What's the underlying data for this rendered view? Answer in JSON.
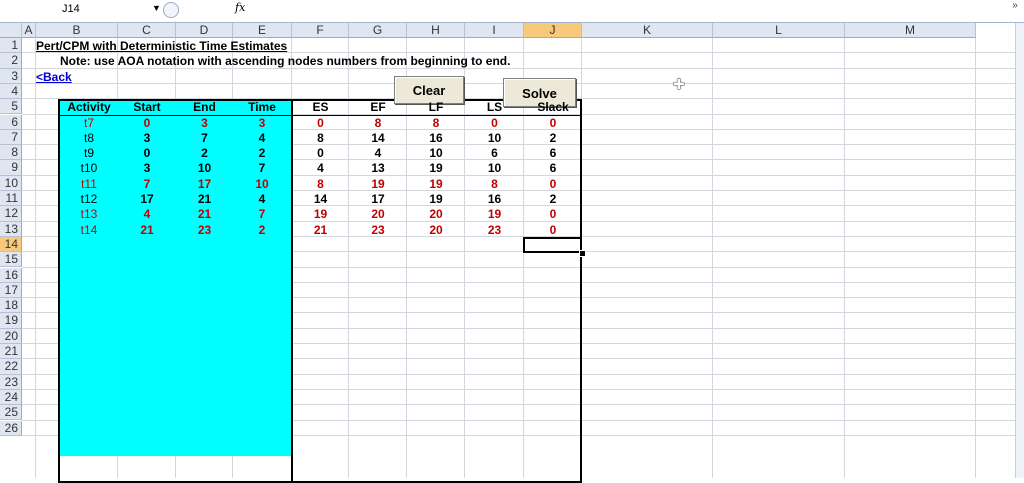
{
  "formula_bar": {
    "cell_ref": "J14",
    "fx_symbol": "fx",
    "expand": "»",
    "content": ""
  },
  "columns": [
    "A",
    "B",
    "C",
    "D",
    "E",
    "F",
    "G",
    "H",
    "I",
    "J",
    "K",
    "L",
    "M"
  ],
  "rows": [
    "1",
    "2",
    "3",
    "4",
    "5",
    "6",
    "7",
    "8",
    "9",
    "10",
    "11",
    "12",
    "13",
    "14",
    "15",
    "16",
    "17",
    "18",
    "19",
    "20",
    "21",
    "22",
    "23",
    "24",
    "25",
    "26"
  ],
  "selected": {
    "column": "J",
    "row": "14"
  },
  "sheet": {
    "title": "Pert/CPM with Deterministic Time Estimates",
    "note": "Note: use AOA notation with ascending nodes numbers from beginning to end.",
    "back_link": "<Back"
  },
  "buttons": {
    "clear": "Clear",
    "solve": "Solve"
  },
  "input_table": {
    "headers": [
      "Activity",
      "Start",
      "End",
      "Time"
    ],
    "rows": [
      {
        "activity": "t7",
        "start": "0",
        "end": "3",
        "time": "3",
        "critical": true
      },
      {
        "activity": "t8",
        "start": "3",
        "end": "7",
        "time": "4",
        "critical": false
      },
      {
        "activity": "t9",
        "start": "0",
        "end": "2",
        "time": "2",
        "critical": false
      },
      {
        "activity": "t10",
        "start": "3",
        "end": "10",
        "time": "7",
        "critical": false
      },
      {
        "activity": "t11",
        "start": "7",
        "end": "17",
        "time": "10",
        "critical": true
      },
      {
        "activity": "t12",
        "start": "17",
        "end": "21",
        "time": "4",
        "critical": false
      },
      {
        "activity": "t13",
        "start": "4",
        "end": "21",
        "time": "7",
        "critical": true
      },
      {
        "activity": "t14",
        "start": "21",
        "end": "23",
        "time": "2",
        "critical": true
      }
    ]
  },
  "output_table": {
    "headers": [
      "ES",
      "EF",
      "LF",
      "LS",
      "Slack"
    ],
    "rows": [
      {
        "es": "0",
        "ef": "8",
        "lf": "8",
        "ls": "0",
        "slack": "0",
        "critical": true
      },
      {
        "es": "8",
        "ef": "14",
        "lf": "16",
        "ls": "10",
        "slack": "2",
        "critical": false
      },
      {
        "es": "0",
        "ef": "4",
        "lf": "10",
        "ls": "6",
        "slack": "6",
        "critical": false
      },
      {
        "es": "4",
        "ef": "13",
        "lf": "19",
        "ls": "10",
        "slack": "6",
        "critical": false
      },
      {
        "es": "8",
        "ef": "19",
        "lf": "19",
        "ls": "8",
        "slack": "0",
        "critical": true
      },
      {
        "es": "14",
        "ef": "17",
        "lf": "19",
        "ls": "16",
        "slack": "2",
        "critical": false
      },
      {
        "es": "19",
        "ef": "20",
        "lf": "20",
        "ls": "19",
        "slack": "0",
        "critical": true
      },
      {
        "es": "21",
        "ef": "23",
        "lf": "20",
        "ls": "23",
        "slack": "0",
        "critical": true
      }
    ]
  },
  "colors": {
    "critical": "#c00000",
    "input_fill": "#00ffff",
    "header_selected": "#f8c97a"
  }
}
